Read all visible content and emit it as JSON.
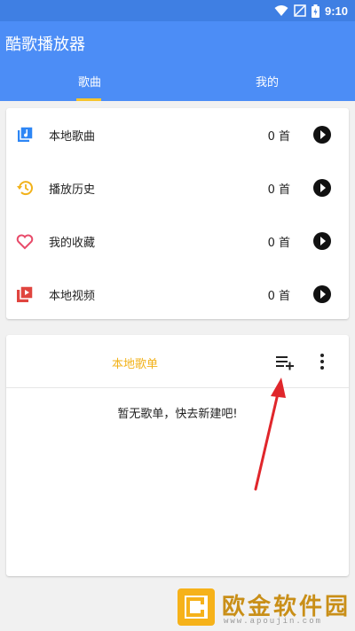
{
  "status_bar": {
    "time": "9:10"
  },
  "app": {
    "title": "酷歌播放器"
  },
  "tabs": [
    {
      "label": "歌曲",
      "active": true
    },
    {
      "label": "我的",
      "active": false
    }
  ],
  "menu": {
    "items": [
      {
        "label": "本地歌曲",
        "count": "0 首",
        "icon": "music-library-icon"
      },
      {
        "label": "播放历史",
        "count": "0 首",
        "icon": "history-icon"
      },
      {
        "label": "我的收藏",
        "count": "0 首",
        "icon": "heart-icon"
      },
      {
        "label": "本地视频",
        "count": "0 首",
        "icon": "video-icon"
      }
    ]
  },
  "playlist": {
    "title": "本地歌单",
    "empty_text": "暂无歌单，快去新建吧!"
  },
  "watermark": {
    "text": "欧金软件园",
    "url": "www.apoujin.com"
  },
  "colors": {
    "primary": "#4c8df6",
    "status_bar": "#3f7fe3",
    "accent": "#f6c42c",
    "playlist_title": "#f2b21a",
    "annotation_arrow": "#e0262b"
  }
}
